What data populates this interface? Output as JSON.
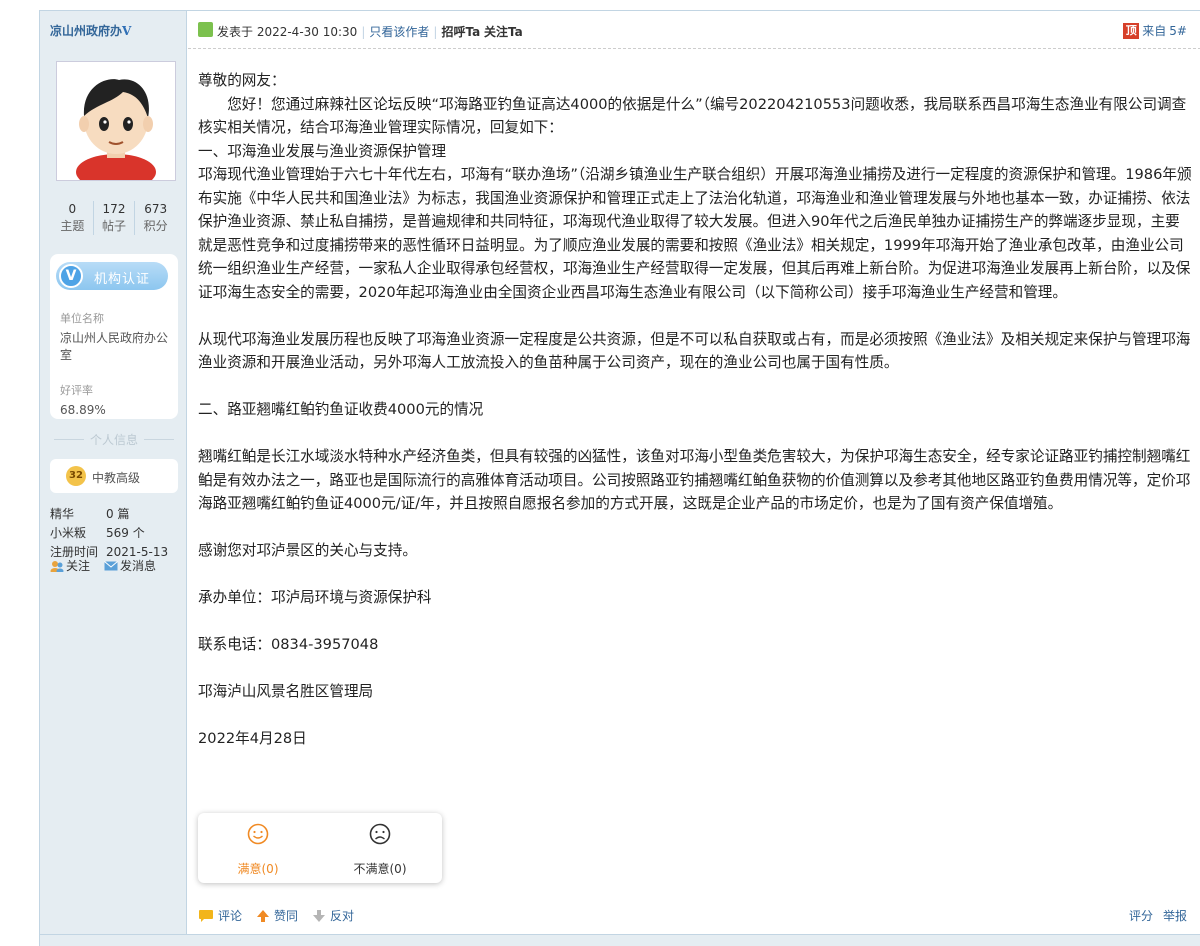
{
  "sidebar": {
    "author_name": "凉山州政府办",
    "author_badge": "V",
    "stats": [
      {
        "num": "0",
        "label": "主题"
      },
      {
        "num": "172",
        "label": "帖子"
      },
      {
        "num": "673",
        "label": "积分"
      }
    ],
    "cert": {
      "button_label": "机构认证",
      "unit_label": "单位名称",
      "unit_value": "凉山州人民政府办公室",
      "rating_label": "好评率",
      "rating_value": "68.89%"
    },
    "personal_title": "个人信息",
    "rank": {
      "level": "32",
      "name": "中教高级"
    },
    "info": [
      {
        "key": "精华",
        "value": "0 篇"
      },
      {
        "key": "小米粄",
        "value": "569 个"
      },
      {
        "key": "注册时间",
        "value": "2021-5-13"
      }
    ],
    "actions": {
      "follow": "关注",
      "message": "发消息"
    }
  },
  "post": {
    "posted_at": "发表于 2022-4-30 10:30",
    "only_author": "只看该作者",
    "greet": "招呼Ta",
    "follow": "关注Ta",
    "from": "来自",
    "floor": "5#",
    "from_badge": "顶"
  },
  "content": {
    "salutation": "尊敬的网友：",
    "intro": "　　您好！您通过麻辣社区论坛反映“邛海路亚钓鱼证高达4000的依据是什么”（编号202204210553问题收悉，我局联系西昌邛海生态渔业有限公司调查核实相关情况，结合邛海渔业管理实际情况，回复如下：",
    "heading1": "一、邛海渔业发展与渔业资源保护管理",
    "para1": "邛海现代渔业管理始于六七十年代左右，邛海有“联办渔场”（沿湖乡镇渔业生产联合组织）开展邛海渔业捕捞及进行一定程度的资源保护和管理。1986年颁布实施《中华人民共和国渔业法》为标志，我国渔业资源保护和管理正式走上了法治化轨道，邛海渔业和渔业管理发展与外地也基本一致，办证捕捞、依法保护渔业资源、禁止私自捕捞，是普遍规律和共同特征，邛海现代渔业取得了较大发展。但进入90年代之后渔民单独办证捕捞生产的弊端逐步显现，主要就是恶性竞争和过度捕捞带来的恶性循环日益明显。为了顺应渔业发展的需要和按照《渔业法》相关规定，1999年邛海开始了渔业承包改革，由渔业公司统一组织渔业生产经营，一家私人企业取得承包经营权，邛海渔业生产经营取得一定发展，但其后再难上新台阶。为促进邛海渔业发展再上新台阶，以及保证邛海生态安全的需要，2020年起邛海渔业由全国资企业西昌邛海生态渔业有限公司（以下简称公司）接手邛海渔业生产经营和管理。",
    "para2": "从现代邛海渔业发展历程也反映了邛海渔业资源一定程度是公共资源，但是不可以私自获取或占有，而是必须按照《渔业法》及相关规定来保护与管理邛海渔业资源和开展渔业活动，另外邛海人工放流投入的鱼苗种属于公司资产，现在的渔业公司也属于国有性质。",
    "heading2": "二、路亚翘嘴红鲌钓鱼证收费4000元的情况",
    "para3": "翘嘴红鲌是长江水域淡水特种水产经济鱼类，但具有较强的凶猛性，该鱼对邛海小型鱼类危害较大，为保护邛海生态安全，经专家论证路亚钓捕控制翘嘴红鲌是有效办法之一，路亚也是国际流行的高雅体育活动项目。公司按照路亚钓捕翘嘴红鲌鱼获物的价值测算以及参考其他地区路亚钓鱼费用情况等，定价邛海路亚翘嘴红鲌钓鱼证4000元/证/年，并且按照自愿报名参加的方式开展，这既是企业产品的市场定价，也是为了国有资产保值增殖。",
    "thanks": "感谢您对邛泸景区的关心与支持。",
    "handler": "承办单位：邛泸局环境与资源保护科",
    "phone": "联系电话：0834-3957048",
    "org": "邛海泸山风景名胜区管理局",
    "date": "2022年4月28日"
  },
  "rating": {
    "satisfied": "满意(0)",
    "unsatisfied": "不满意(0)",
    "satisfied_color": "#f08a24",
    "unsatisfied_color": "#333333"
  },
  "footer": {
    "comment": "评论",
    "agree": "赞同",
    "oppose": "反对",
    "rate": "评分",
    "report": "举报"
  }
}
